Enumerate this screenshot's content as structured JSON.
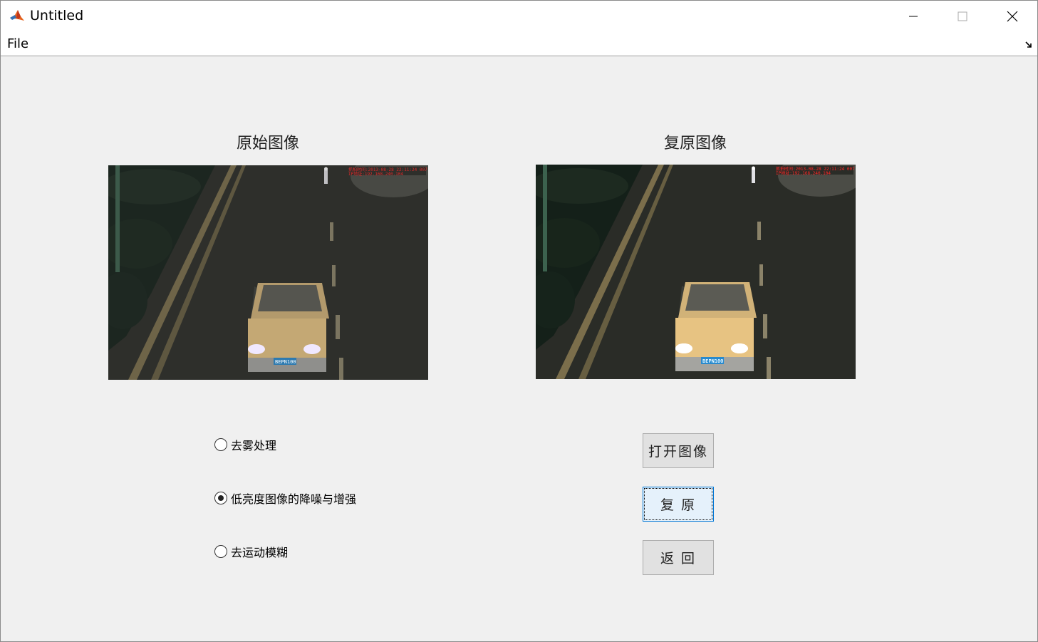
{
  "window": {
    "title": "Untitled"
  },
  "menu": {
    "file": "File"
  },
  "images": {
    "original_title": "原始图像",
    "restored_title": "复原图像",
    "plate_text": "BEPN100"
  },
  "options": [
    {
      "label": "去雾处理",
      "checked": false
    },
    {
      "label": "低亮度图像的降噪与增强",
      "checked": true
    },
    {
      "label": "去运动模糊",
      "checked": false
    }
  ],
  "buttons": {
    "open": "打开图像",
    "restore": "复 原",
    "back": "返 回"
  },
  "colors": {
    "window_bg": "#f0f0f0",
    "focus_border": "#0078d7",
    "button_bg": "#e1e1e1"
  }
}
